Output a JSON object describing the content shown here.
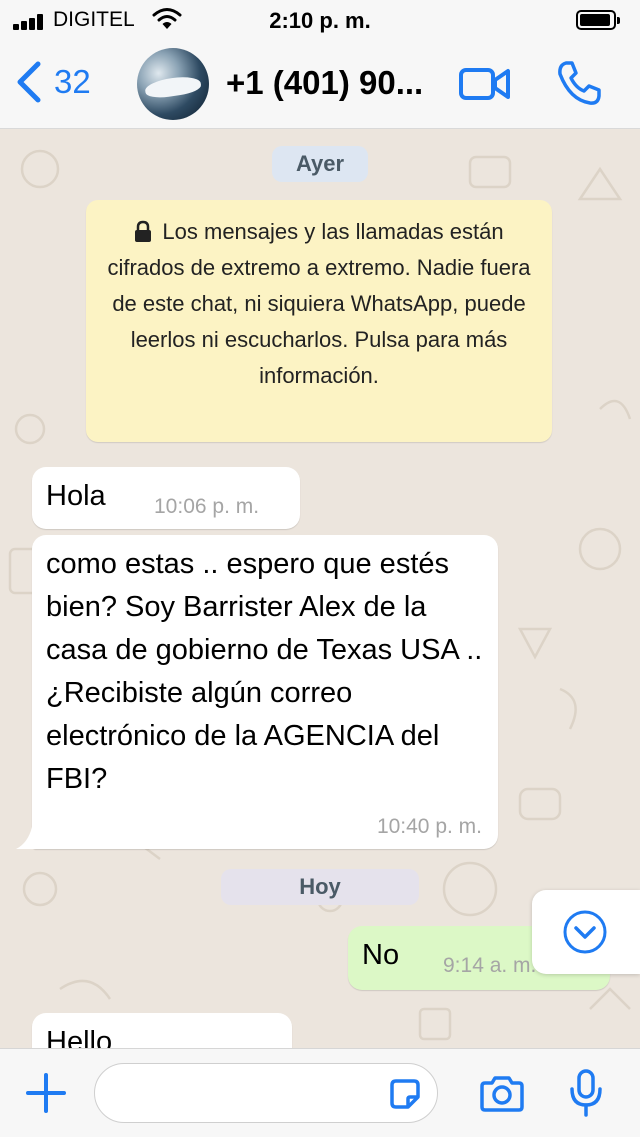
{
  "status_bar": {
    "carrier": "DIGITEL",
    "time": "2:10 p. m.",
    "battery_level": 0.95
  },
  "header": {
    "back_count": "32",
    "contact_name": "+1 (401) 90..."
  },
  "chat": {
    "date_yesterday": "Ayer",
    "encryption_notice": "Los mensajes y las llamadas están cifrados de extremo a extremo. Nadie fuera de este chat, ni siquiera WhatsApp, puede leerlos ni escucharlos. Pulsa para más información.",
    "messages": [
      {
        "direction": "incoming",
        "text": "Hola",
        "time": "10:06 p. m."
      },
      {
        "direction": "incoming",
        "text": "como estas .. espero que estés bien? Soy Barrister Alex de la casa de gobierno de Texas USA .. ¿Recibiste algún correo electrónico de la AGENCIA del FBI?",
        "time": "10:40 p. m."
      },
      {
        "direction": "outgoing",
        "text": "No",
        "time": "9:14 a. m."
      },
      {
        "direction": "incoming",
        "text": "Hello",
        "time": ""
      }
    ],
    "date_today": "Hoy"
  },
  "input": {
    "value": "",
    "placeholder": ""
  },
  "colors": {
    "accent": "#1f7bf2",
    "chat_background": "#ece5dd",
    "outgoing_bubble": "#dcf8c6",
    "incoming_bubble": "#ffffff",
    "encryption_card": "#fcf3c4"
  },
  "icons": [
    "signal-icon",
    "wifi-icon",
    "battery-icon",
    "back-chevron-icon",
    "avatar",
    "video-call-icon",
    "phone-icon",
    "lock-icon",
    "read-ticks-icon",
    "scroll-down-icon",
    "plus-icon",
    "sticker-icon",
    "camera-icon",
    "microphone-icon"
  ]
}
